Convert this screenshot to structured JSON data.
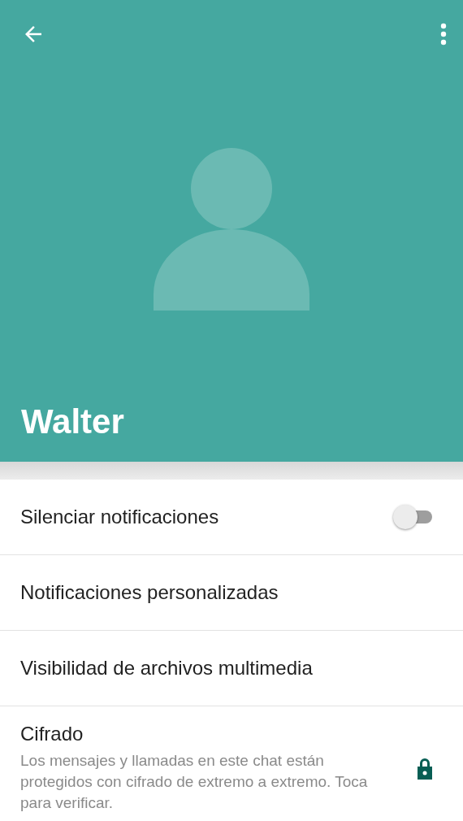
{
  "header": {
    "title": "Walter"
  },
  "settings": [
    {
      "kind": "toggle",
      "label": "Silenciar notificaciones",
      "on": false
    },
    {
      "kind": "plain",
      "label": "Notificaciones personalizadas"
    },
    {
      "kind": "plain",
      "label": "Visibilidad de archivos multimedia"
    },
    {
      "kind": "secure",
      "label": "Cifrado",
      "description": "Los mensajes y llamadas en este chat están protegidos con cifrado de extremo a extremo. Toca para verificar."
    }
  ]
}
